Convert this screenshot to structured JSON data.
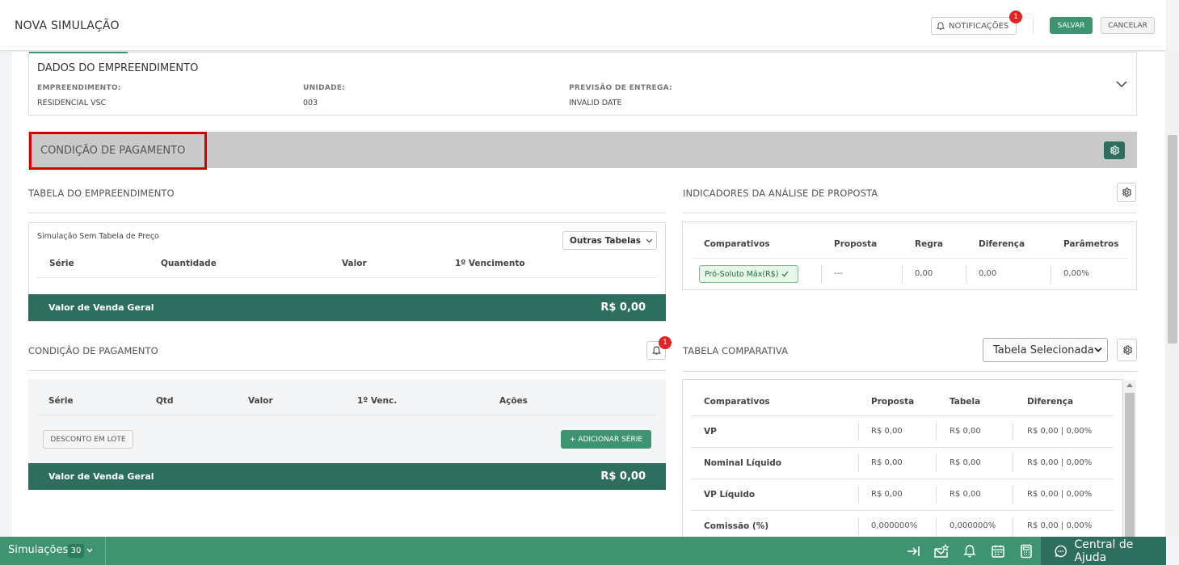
{
  "header": {
    "title": "NOVA SIMULAÇÃO",
    "notifications_label": "NOTIFICAÇÕES",
    "notifications_count": "1",
    "save_label": "SALVAR",
    "cancel_label": "CANCELAR"
  },
  "empreendimento": {
    "title": "DADOS DO EMPREENDIMENTO",
    "fields": [
      {
        "label": "EMPREENDIMENTO:",
        "value": "RESIDENCIAL VSC"
      },
      {
        "label": "UNIDADE:",
        "value": "003"
      },
      {
        "label": "PREVISÃO DE ENTREGA:",
        "value": "INVALID DATE"
      }
    ]
  },
  "condicao_section": {
    "title": "CONDIÇÃO DE PAGAMENTO"
  },
  "tabela_empreendimento": {
    "title": "TABELA DO EMPREENDIMENTO",
    "subtitle": "Simulação Sem Tabela de Preço",
    "other_tables_label": "Outras Tabelas",
    "columns": [
      "Série",
      "Quantidade",
      "Valor",
      "1º Vencimento"
    ],
    "footer_label": "Valor de Venda Geral",
    "footer_value": "R$ 0,00"
  },
  "indicadores": {
    "title": "INDICADORES DA ANÁLISE DE PROPOSTA",
    "columns": [
      "Comparativos",
      "Proposta",
      "Regra",
      "Diferença",
      "Parâmetros"
    ],
    "row": {
      "label": "Pró-Soluto Máx(R$)",
      "proposta": "---",
      "regra": "0,00",
      "diferenca": "0,00",
      "parametros": "0,00%"
    }
  },
  "condicao_pagamento": {
    "title": "CONDIÇÃO DE PAGAMENTO",
    "bell_count": "1",
    "columns": [
      "Série",
      "Qtd",
      "Valor",
      "1º Venc.",
      "Ações"
    ],
    "discount_label": "DESCONTO EM LOTE",
    "add_series_label": "+ ADICIONAR SÉRIE",
    "footer_label": "Valor de Venda Geral",
    "footer_value": "R$ 0,00"
  },
  "tabela_comparativa": {
    "title": "TABELA COMPARATIVA",
    "select_value": "Tabela Selecionada",
    "columns": [
      "Comparativos",
      "Proposta",
      "Tabela",
      "Diferença"
    ],
    "rows": [
      {
        "label": "VP",
        "proposta": "R$ 0,00",
        "tabela": "R$ 0,00",
        "diferenca": "R$ 0,00 | 0,00%"
      },
      {
        "label": "Nominal Líquido",
        "proposta": "R$ 0,00",
        "tabela": "R$ 0,00",
        "diferenca": "R$ 0,00 | 0,00%"
      },
      {
        "label": "VP Líquido",
        "proposta": "R$ 0,00",
        "tabela": "R$ 0,00",
        "diferenca": "R$ 0,00 | 0,00%"
      },
      {
        "label": "Comissão (%)",
        "proposta": "0,000000%",
        "tabela": "0,000000%",
        "diferenca": "R$ 0,00 | 0,00%"
      }
    ]
  },
  "bottombar": {
    "simulations_label": "Simulações",
    "simulations_count": "30",
    "help_label": "Central de Ajuda",
    "icons": [
      "collapse-arrow-icon",
      "mail-star-icon",
      "bell-icon",
      "calendar-icon",
      "calculator-icon",
      "chat-icon"
    ]
  },
  "colors": {
    "primary_green": "#3e9470",
    "dark_green": "#2e6e5f",
    "alert_red": "#e02424"
  }
}
